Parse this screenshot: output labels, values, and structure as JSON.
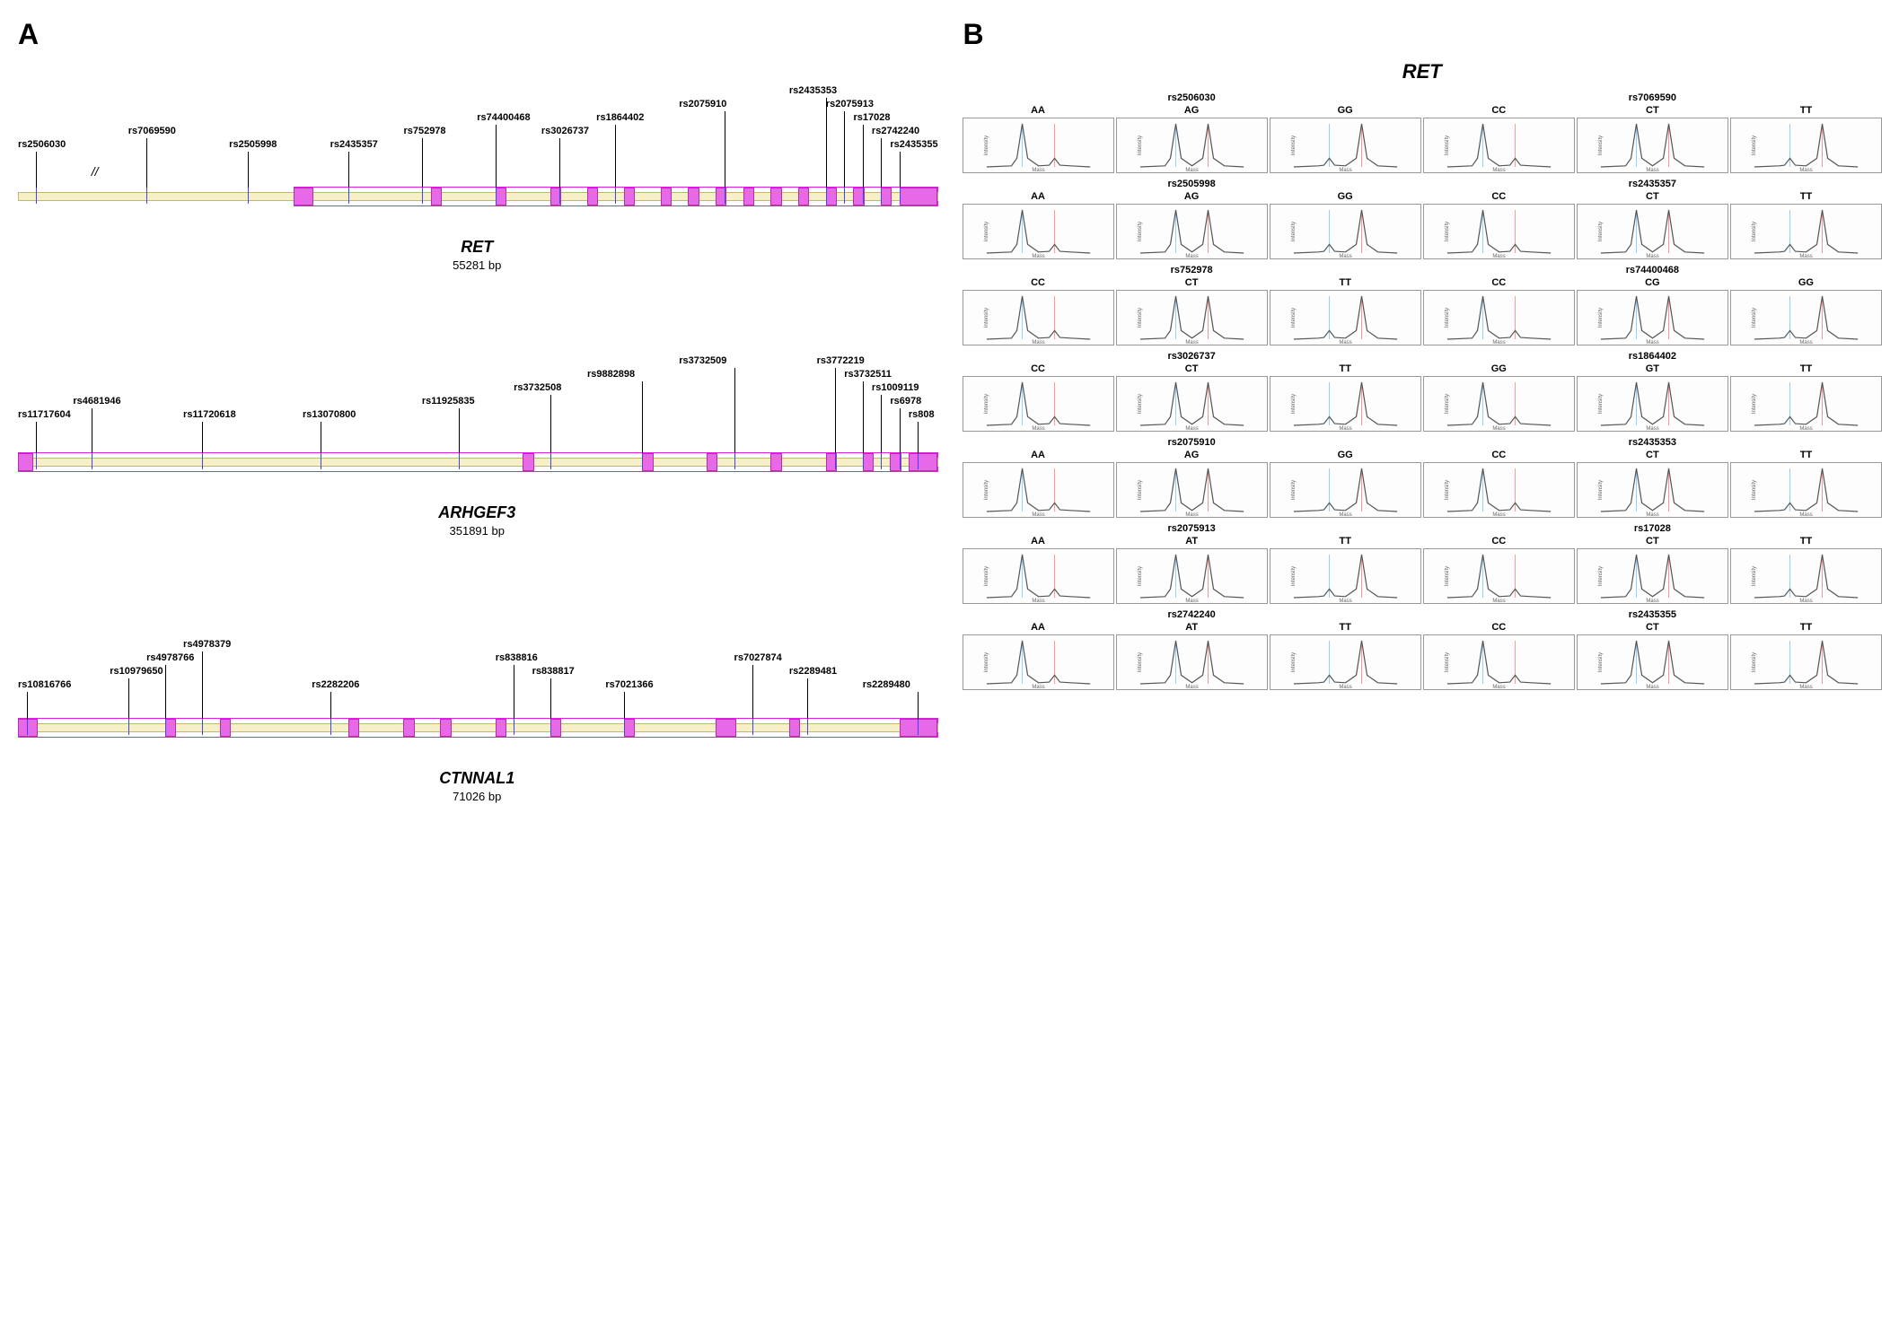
{
  "panelA": {
    "label": "A",
    "genes": [
      {
        "name": "RET",
        "size": "55281 bp",
        "snps": [
          "rs2506030",
          "rs7069590",
          "rs2505998",
          "rs2435357",
          "rs752978",
          "rs74400468",
          "rs3026737",
          "rs1864402",
          "rs2075910",
          "rs2435353",
          "rs2075913",
          "rs17028",
          "rs2742240",
          "rs2435355"
        ]
      },
      {
        "name": "ARHGEF3",
        "size": "351891 bp",
        "snps": [
          "rs11717604",
          "rs4681946",
          "rs11720618",
          "rs13070800",
          "rs11925835",
          "rs3732508",
          "rs9882898",
          "rs3732509",
          "rs3772219",
          "rs3732511",
          "rs1009119",
          "rs6978",
          "rs808"
        ]
      },
      {
        "name": "CTNNAL1",
        "size": "71026 bp",
        "snps": [
          "rs10816766",
          "rs10979650",
          "rs4978766",
          "rs4978379",
          "rs2282206",
          "rs838816",
          "rs838817",
          "rs7021366",
          "rs7027874",
          "rs2289481",
          "rs2289480"
        ]
      }
    ]
  },
  "panelB": {
    "label": "B",
    "title": "RET",
    "rows": [
      {
        "left": {
          "rs": "rs2506030",
          "gts": [
            "AA",
            "AG",
            "GG"
          ]
        },
        "right": {
          "rs": "rs7069590",
          "gts": [
            "CC",
            "CT",
            "TT"
          ]
        }
      },
      {
        "left": {
          "rs": "rs2505998",
          "gts": [
            "AA",
            "AG",
            "GG"
          ]
        },
        "right": {
          "rs": "rs2435357",
          "gts": [
            "CC",
            "CT",
            "TT"
          ]
        }
      },
      {
        "left": {
          "rs": "rs752978",
          "gts": [
            "CC",
            "CT",
            "TT"
          ]
        },
        "right": {
          "rs": "rs74400468",
          "gts": [
            "CC",
            "CG",
            "GG"
          ]
        }
      },
      {
        "left": {
          "rs": "rs3026737",
          "gts": [
            "CC",
            "CT",
            "TT"
          ]
        },
        "right": {
          "rs": "rs1864402",
          "gts": [
            "GG",
            "GT",
            "TT"
          ]
        }
      },
      {
        "left": {
          "rs": "rs2075910",
          "gts": [
            "AA",
            "AG",
            "GG"
          ]
        },
        "right": {
          "rs": "rs2435353",
          "gts": [
            "CC",
            "CT",
            "TT"
          ]
        }
      },
      {
        "left": {
          "rs": "rs2075913",
          "gts": [
            "AA",
            "AT",
            "TT"
          ]
        },
        "right": {
          "rs": "rs17028",
          "gts": [
            "CC",
            "CT",
            "TT"
          ]
        }
      },
      {
        "left": {
          "rs": "rs2742240",
          "gts": [
            "AA",
            "AT",
            "TT"
          ]
        },
        "right": {
          "rs": "rs2435355",
          "gts": [
            "CC",
            "CT",
            "TT"
          ]
        }
      }
    ],
    "axis": {
      "x": "Mass",
      "y": "Intensity"
    }
  },
  "chart_data": {
    "type": "diagram",
    "description": "Panel A: gene structure diagrams for RET (55281 bp), ARHGEF3 (351891 bp), CTNNAL1 (71026 bp) with SNP positions marked. Panel B: MassARRAY spectra thumbnails for 14 RET SNPs × 3 genotypes each; y=Intensity, x=Mass, peaks indicate allele calls.",
    "genes": [
      {
        "name": "RET",
        "length_bp": 55281,
        "snp_count": 14
      },
      {
        "name": "ARHGEF3",
        "length_bp": 351891,
        "snp_count": 13
      },
      {
        "name": "CTNNAL1",
        "length_bp": 71026,
        "snp_count": 11
      }
    ]
  }
}
